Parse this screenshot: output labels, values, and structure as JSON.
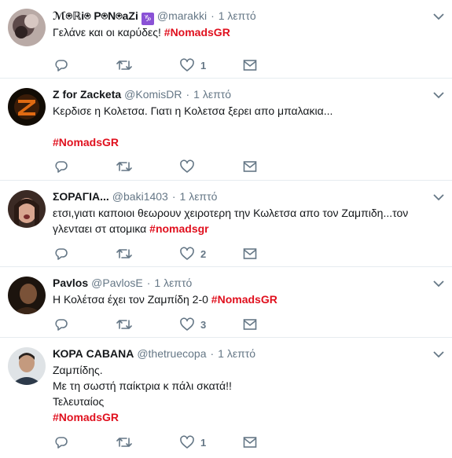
{
  "colors": {
    "hashtag": "#e0101e",
    "muted": "#657786",
    "border": "#e6ecf0"
  },
  "tweets": [
    {
      "name": "ℳ⍟ℝi⍟ P⍟N⍟aZi",
      "badge": "♑",
      "handle": "@marakki",
      "dot": "·",
      "time": "1 λεπτό",
      "lines": [
        {
          "text": "Γελάνε και οι καρύδες! ",
          "tag": "#NomadsGR"
        }
      ],
      "likes": "1",
      "icons": [
        "reply-icon",
        "retweet-icon",
        "heart-icon",
        "message-icon",
        "chevron-down-icon"
      ]
    },
    {
      "name": "Z for Zacketa",
      "handle": "@KomisDR",
      "dot": "·",
      "time": "1 λεπτό",
      "lines": [
        {
          "text": "Κερδισε η Κολετσα. Γιατι  η Κολετσα ξερει απο μπαλακια..."
        },
        {
          "text": ""
        },
        {
          "tag": "#NomadsGR"
        }
      ],
      "likes": ""
    },
    {
      "name": "ΣΟΡΑΓΙΑ...",
      "handle": "@baki1403",
      "dot": "·",
      "time": "1 λεπτό",
      "lines": [
        {
          "text": "ετσι,γιατι καποιοι θεωρουν χειροτερη την Κωλετσα απο τον Ζαμπιδη...τον"
        },
        {
          "text": "γλενταει στ ατομικα ",
          "tag": "#nomadsgr"
        }
      ],
      "likes": "2"
    },
    {
      "name": "Pavlos",
      "handle": "@PavlosE",
      "dot": "·",
      "time": "1 λεπτό",
      "lines": [
        {
          "text": "Η Κολέτσα έχει τον Ζαμπίδη 2-0 ",
          "tag": "#NomadsGR"
        }
      ],
      "likes": "3"
    },
    {
      "name": "ΚΟΡΑ CABANA",
      "handle": "@thetruecopa",
      "dot": "·",
      "time": "1 λεπτό",
      "lines": [
        {
          "text": "Ζαμπίδης."
        },
        {
          "text": "Με τη σωστή παίκτρια κ πάλι σκατά!!"
        },
        {
          "text": "Τελευταίος"
        },
        {
          "tag": "#NomadsGR"
        }
      ],
      "likes": "1"
    }
  ]
}
